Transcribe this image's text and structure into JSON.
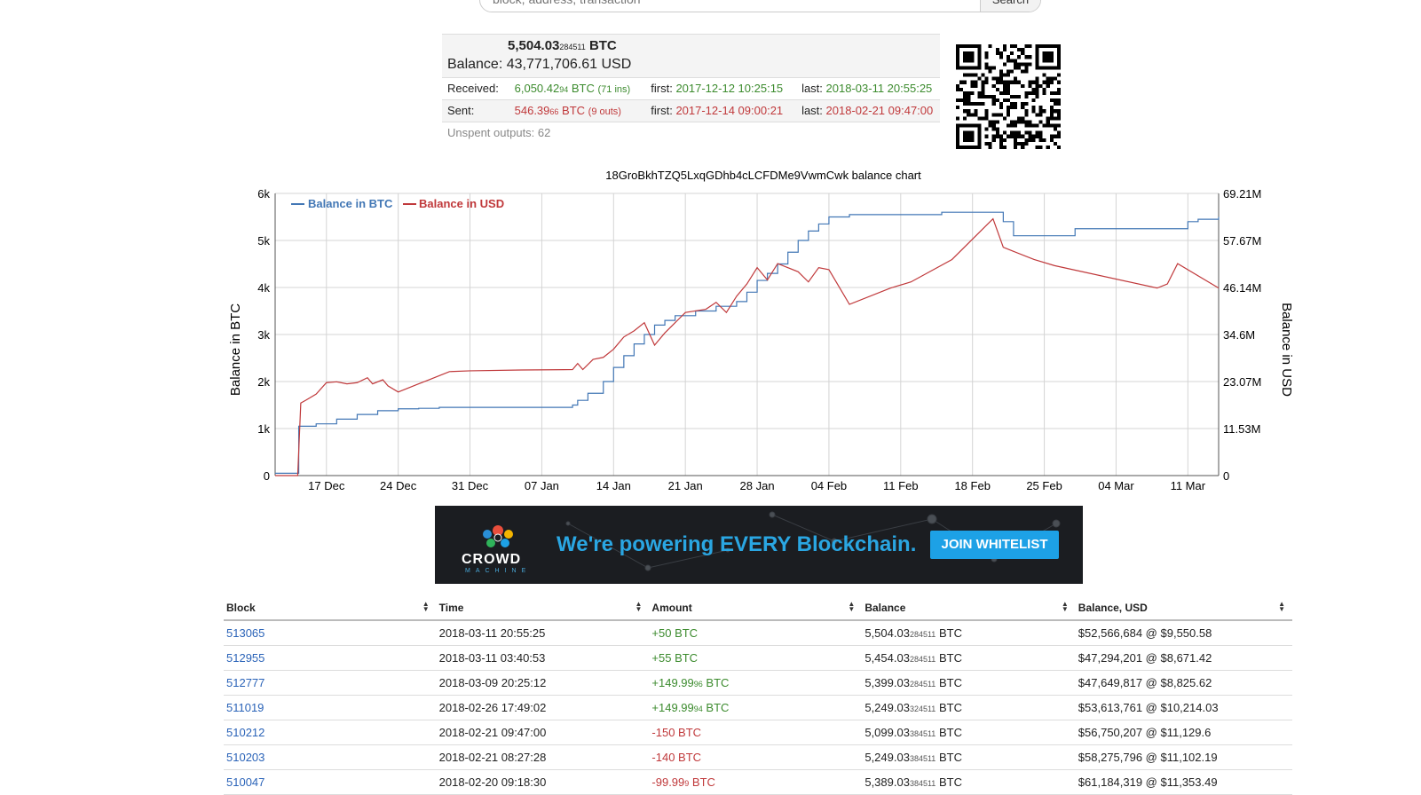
{
  "search": {
    "placeholder": "block, address, transaction",
    "button": "Search"
  },
  "summary": {
    "btc_main": "5,504.03",
    "btc_small": "284511",
    "btc_unit": "BTC",
    "balance_label": "Balance:",
    "balance_usd": "43,771,706.61 USD",
    "received": {
      "label": "Received:",
      "main": "6,050.42",
      "small": "94",
      "unit": "BTC",
      "count": "(71 ins)",
      "first_label": "first:",
      "first": "2017-12-12 10:25:15",
      "last_label": "last:",
      "last": "2018-03-11 20:55:25"
    },
    "sent": {
      "label": "Sent:",
      "main": "546.39",
      "small": "66",
      "unit": "BTC",
      "count": "(9 outs)",
      "first_label": "first:",
      "first": "2017-12-14 09:00:21",
      "last_label": "last:",
      "last": "2018-02-21 09:47:00"
    },
    "unspent": "Unspent outputs: 62"
  },
  "chart_data": {
    "type": "line",
    "title": "18GroBkhTZQ5LxqGDhb4cLCFDMe9VwmCwk balance chart",
    "ylabel": "Balance in BTC",
    "y2label": "Balance in USD",
    "x_tick_labels": [
      "17 Dec",
      "24 Dec",
      "31 Dec",
      "07 Jan",
      "14 Jan",
      "21 Jan",
      "28 Jan",
      "04 Feb",
      "11 Feb",
      "18 Feb",
      "25 Feb",
      "04 Mar",
      "11 Mar"
    ],
    "y_tick_labels": [
      "0",
      "1k",
      "2k",
      "3k",
      "4k",
      "5k",
      "6k"
    ],
    "y2_tick_labels": [
      "0",
      "11.53M",
      "23.07M",
      "34.6M",
      "46.14M",
      "57.67M",
      "69.21M"
    ],
    "xlim_days": [
      0,
      92
    ],
    "ylim": [
      0,
      6000
    ],
    "y2lim": [
      0,
      69210000
    ],
    "grid": true,
    "legend": "top-left",
    "series": [
      {
        "name": "Balance in BTC",
        "color": "#4277b5",
        "points": [
          [
            0.0,
            50
          ],
          [
            1.5,
            50
          ],
          [
            2.3,
            1050
          ],
          [
            4,
            1100
          ],
          [
            6,
            1200
          ],
          [
            8,
            1300
          ],
          [
            10,
            1380
          ],
          [
            12,
            1420
          ],
          [
            14,
            1430
          ],
          [
            16,
            1450
          ],
          [
            18,
            1450
          ],
          [
            26,
            1450
          ],
          [
            29,
            1500
          ],
          [
            29.5,
            1600
          ],
          [
            30.5,
            1750
          ],
          [
            32,
            2000
          ],
          [
            33,
            2300
          ],
          [
            34,
            2550
          ],
          [
            35,
            2800
          ],
          [
            36,
            3000
          ],
          [
            37,
            3200
          ],
          [
            38,
            3300
          ],
          [
            39,
            3400
          ],
          [
            41,
            3500
          ],
          [
            43,
            3600
          ],
          [
            45,
            3700
          ],
          [
            46,
            3900
          ],
          [
            47,
            4150
          ],
          [
            48,
            4300
          ],
          [
            49,
            4500
          ],
          [
            50,
            4750
          ],
          [
            51,
            5000
          ],
          [
            52,
            5200
          ],
          [
            53,
            5350
          ],
          [
            54,
            5500
          ],
          [
            56,
            5550
          ],
          [
            60,
            5550
          ],
          [
            65,
            5600
          ],
          [
            70,
            5600
          ],
          [
            71,
            5400
          ],
          [
            72,
            5100
          ],
          [
            76,
            5100
          ],
          [
            78,
            5250
          ],
          [
            88,
            5250
          ],
          [
            89,
            5400
          ],
          [
            90,
            5450
          ],
          [
            92,
            5500
          ]
        ]
      },
      {
        "name": "Balance in USD",
        "color": "#c0393b",
        "points": [
          [
            0.0,
            0
          ],
          [
            2.2,
            0
          ],
          [
            2.5,
            17800000
          ],
          [
            3,
            18500000
          ],
          [
            4,
            20000000
          ],
          [
            5,
            22800000
          ],
          [
            6,
            23000000
          ],
          [
            7,
            22500000
          ],
          [
            8,
            22800000
          ],
          [
            9,
            24000000
          ],
          [
            9.5,
            22500000
          ],
          [
            10.5,
            23500000
          ],
          [
            11,
            22000000
          ],
          [
            12,
            20500000
          ],
          [
            13,
            21500000
          ],
          [
            14,
            22500000
          ],
          [
            15,
            23500000
          ],
          [
            16,
            24500000
          ],
          [
            17,
            25500000
          ],
          [
            19,
            25700000
          ],
          [
            24,
            25900000
          ],
          [
            29,
            26000000
          ],
          [
            29.5,
            27500000
          ],
          [
            30,
            26000000
          ],
          [
            31,
            28500000
          ],
          [
            32,
            29000000
          ],
          [
            33,
            31000000
          ],
          [
            34,
            34000000
          ],
          [
            35,
            35500000
          ],
          [
            36,
            37500000
          ],
          [
            37,
            32000000
          ],
          [
            38,
            35000000
          ],
          [
            39,
            37500000
          ],
          [
            40,
            40000000
          ],
          [
            42,
            40800000
          ],
          [
            43,
            42500000
          ],
          [
            44,
            40000000
          ],
          [
            45,
            44000000
          ],
          [
            46,
            47000000
          ],
          [
            47,
            51000000
          ],
          [
            48,
            48000000
          ],
          [
            49,
            52000000
          ],
          [
            50,
            51000000
          ],
          [
            51,
            50000000
          ],
          [
            52,
            47500000
          ],
          [
            53,
            51000000
          ],
          [
            54,
            50500000
          ],
          [
            56,
            42000000
          ],
          [
            60,
            46000000
          ],
          [
            62,
            47500000
          ],
          [
            66,
            53000000
          ],
          [
            70,
            63000000
          ],
          [
            71,
            56000000
          ],
          [
            72,
            55000000
          ],
          [
            74,
            53000000
          ],
          [
            76,
            51500000
          ],
          [
            86,
            46000000
          ],
          [
            87,
            47000000
          ],
          [
            88,
            52000000
          ],
          [
            92,
            46000000
          ]
        ]
      }
    ]
  },
  "banner": {
    "brand": "CROWD",
    "brand_sub": "MACHINE",
    "headline": "We're powering EVERY Blockchain.",
    "cta": "JOIN WHITELIST"
  },
  "table": {
    "headers": [
      "Block",
      "Time",
      "Amount",
      "Balance",
      "Balance, USD"
    ],
    "rows": [
      {
        "block": "513065",
        "time": "2018-03-11 20:55:25",
        "amount": "+50 BTC",
        "amt_color": "#3c8b2e",
        "bal_main": "5,504.03",
        "bal_small": "284511",
        "bal_unit": "BTC",
        "usd": "$52,566,684 @ $9,550.58"
      },
      {
        "block": "512955",
        "time": "2018-03-11 03:40:53",
        "amount": "+55 BTC",
        "amt_color": "#3c8b2e",
        "bal_main": "5,454.03",
        "bal_small": "284511",
        "bal_unit": "BTC",
        "usd": "$47,294,201 @ $8,671.42"
      },
      {
        "block": "512777",
        "time": "2018-03-09 20:25:12",
        "amount": "+149.99",
        "amt_small": "96",
        "amt_unit": "BTC",
        "amt_color": "#3c8b2e",
        "bal_main": "5,399.03",
        "bal_small": "284511",
        "bal_unit": "BTC",
        "usd": "$47,649,817 @ $8,825.62"
      },
      {
        "block": "511019",
        "time": "2018-02-26 17:49:02",
        "amount": "+149.99",
        "amt_small": "94",
        "amt_unit": "BTC",
        "amt_color": "#3c8b2e",
        "bal_main": "5,249.03",
        "bal_small": "324511",
        "bal_unit": "BTC",
        "usd": "$53,613,761 @ $10,214.03"
      },
      {
        "block": "510212",
        "time": "2018-02-21 09:47:00",
        "amount": "-150 BTC",
        "amt_color": "#c0393b",
        "bal_main": "5,099.03",
        "bal_small": "384511",
        "bal_unit": "BTC",
        "usd": "$56,750,207 @ $11,129.6"
      },
      {
        "block": "510203",
        "time": "2018-02-21 08:27:28",
        "amount": "-140 BTC",
        "amt_color": "#c0393b",
        "bal_main": "5,249.03",
        "bal_small": "384511",
        "bal_unit": "BTC",
        "usd": "$58,275,796 @ $11,102.19"
      },
      {
        "block": "510047",
        "time": "2018-02-20 09:18:30",
        "amount": "-99.99",
        "amt_small": "9",
        "amt_unit": "BTC",
        "amt_color": "#c0393b",
        "bal_main": "5,389.03",
        "bal_small": "384511",
        "bal_unit": "BTC",
        "usd": "$61,184,319 @ $11,353.49"
      }
    ]
  }
}
